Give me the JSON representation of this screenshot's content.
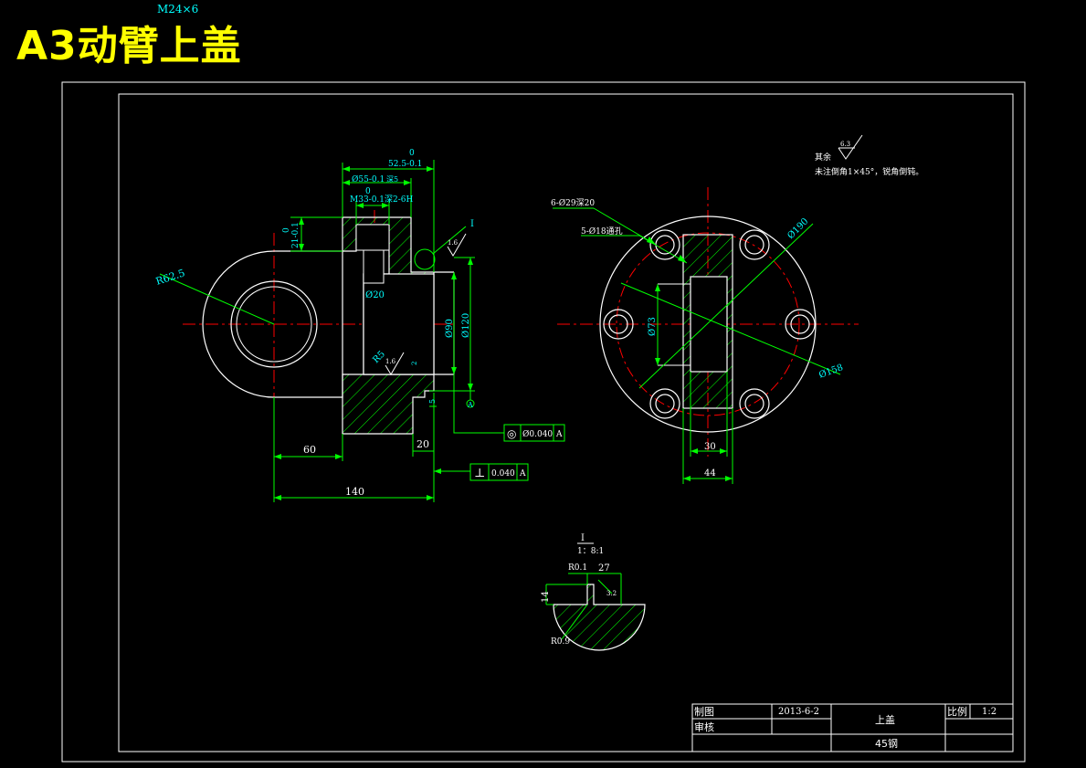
{
  "title": "A3动臂上盖",
  "colors": {
    "background": "#000000",
    "frame": "#ffffff",
    "dimension": "#00ff00",
    "text": "#00ffff",
    "centerline": "#ff0000",
    "hatch": "#00ff00",
    "title": "#ffff00"
  },
  "front_view": {
    "top_note": "M24×6",
    "dims": {
      "d_top_tol": "0",
      "d_52": "52.5-0.1",
      "d_55": "Ø55-0.1",
      "d_55_note": "深5",
      "d_55_tol": "0",
      "d_m33": "M33-0.1深2-6H",
      "d_21": "21-0.1",
      "d_21_tol": "0",
      "d_r62": "R62.5",
      "d_20": "Ø20",
      "d_90": "Ø90",
      "d_120": "Ø120",
      "d_r5": "R5",
      "d_a": "A",
      "d_small": "2",
      "d_5": "5",
      "d_60": "60",
      "d_20b": "20",
      "d_140": "140",
      "detail_ref": "I",
      "roughness_1": "1.6",
      "roughness_2": "1.6"
    },
    "tolerances": [
      {
        "symbol": "◎",
        "value": "Ø0.040",
        "datum": "A"
      },
      {
        "symbol": "⊥",
        "value": "0.040",
        "datum": "A"
      }
    ]
  },
  "side_view": {
    "note_holes_1": "6-Ø29深20",
    "note_holes_2": "5-Ø18通孔",
    "d_190": "Ø190",
    "d_158": "Ø158",
    "d_73": "Ø73",
    "d_30": "30",
    "d_44": "44",
    "general_roughness": "6.3",
    "note_1": "其余",
    "note_2": "未注倒角1×45°，锐角倒钝。"
  },
  "detail_view": {
    "label": "I",
    "scale": "1：8:1",
    "d_r01": "R0.1",
    "d_27": "27",
    "d_14": "14",
    "d_r09": "R0.9",
    "roughness": "3.2"
  },
  "title_block": {
    "drawn_label": "制图",
    "date": "2013-6-2",
    "part_name": "上盖",
    "scale_label": "比例",
    "scale_value": "1:2",
    "checked_label": "审核",
    "material": "45钢"
  }
}
